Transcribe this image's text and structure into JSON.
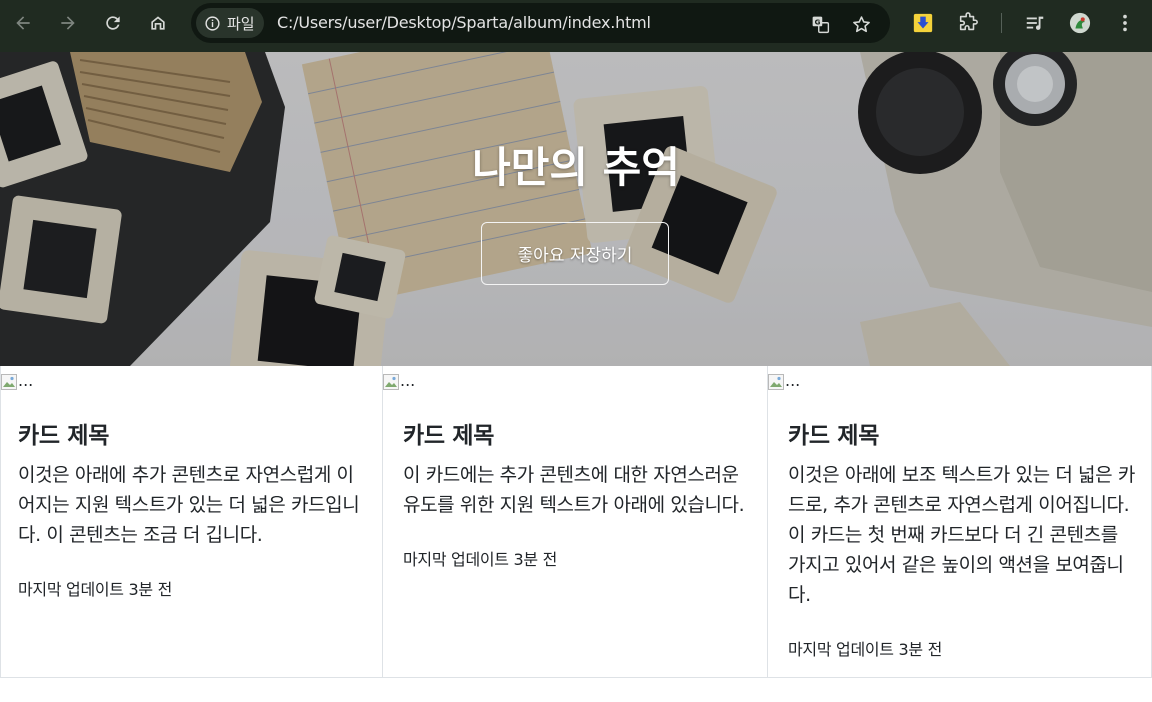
{
  "browser": {
    "site_info_label": "파일",
    "url": "C:/Users/user/Desktop/Sparta/album/index.html",
    "icons": [
      "back-icon",
      "forward-icon",
      "reload-icon",
      "home-icon",
      "info-icon",
      "translate-icon",
      "bookmark-star-icon",
      "extension-download-icon",
      "extensions-puzzle-icon",
      "reading-list-icon",
      "profile-avatar-icon",
      "more-menu-icon"
    ],
    "colors": {
      "toolbar": "#202b21",
      "omnibox": "#101812"
    }
  },
  "hero": {
    "title": "나만의 추억",
    "button_label": "좋아요 저장하기"
  },
  "cards": [
    {
      "img_alt": "...",
      "title": "카드 제목",
      "text": "이것은 아래에 추가 콘텐츠로 자연스럽게 이어지는 지원 텍스트가 있는 더 넓은 카드입니다. 이 콘텐츠는 조금 더 깁니다.",
      "meta": "마지막 업데이트 3분 전"
    },
    {
      "img_alt": "...",
      "title": "카드 제목",
      "text": "이 카드에는 추가 콘텐츠에 대한 자연스러운 유도를 위한 지원 텍스트가 아래에 있습니다.",
      "meta": "마지막 업데이트 3분 전"
    },
    {
      "img_alt": "...",
      "title": "카드 제목",
      "text": "이것은 아래에 보조 텍스트가 있는 더 넓은 카드로, 추가 콘텐츠로 자연스럽게 이어집니다. 이 카드는 첫 번째 카드보다 더 긴 콘텐츠를 가지고 있어서 같은 높이의 액션을 보여줍니다.",
      "meta": "마지막 업데이트 3분 전"
    }
  ]
}
